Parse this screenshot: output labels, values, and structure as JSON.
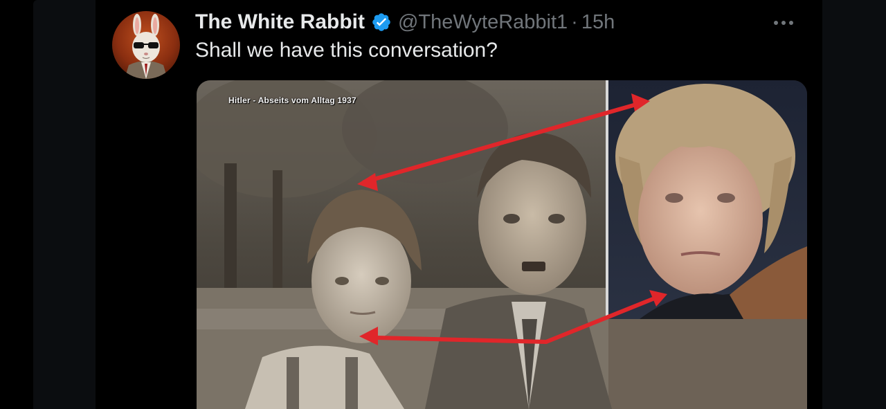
{
  "tweet": {
    "display_name": "The White Rabbit",
    "handle": "@TheWyteRabbit1",
    "separator": "·",
    "timestamp": "15h",
    "text": "Shall we have this conversation?",
    "more_label": "More options"
  },
  "media": {
    "caption": "Hitler - Abseits vom Alltag 1937",
    "arrow_color": "#e0262a"
  },
  "colors": {
    "background": "#000000",
    "primary_text": "#e7e9ea",
    "secondary_text": "#71767b",
    "verified_badge": "#1d9bf0"
  },
  "icons": {
    "verified": "verified-badge-icon",
    "more": "more-horizontal-icon"
  }
}
